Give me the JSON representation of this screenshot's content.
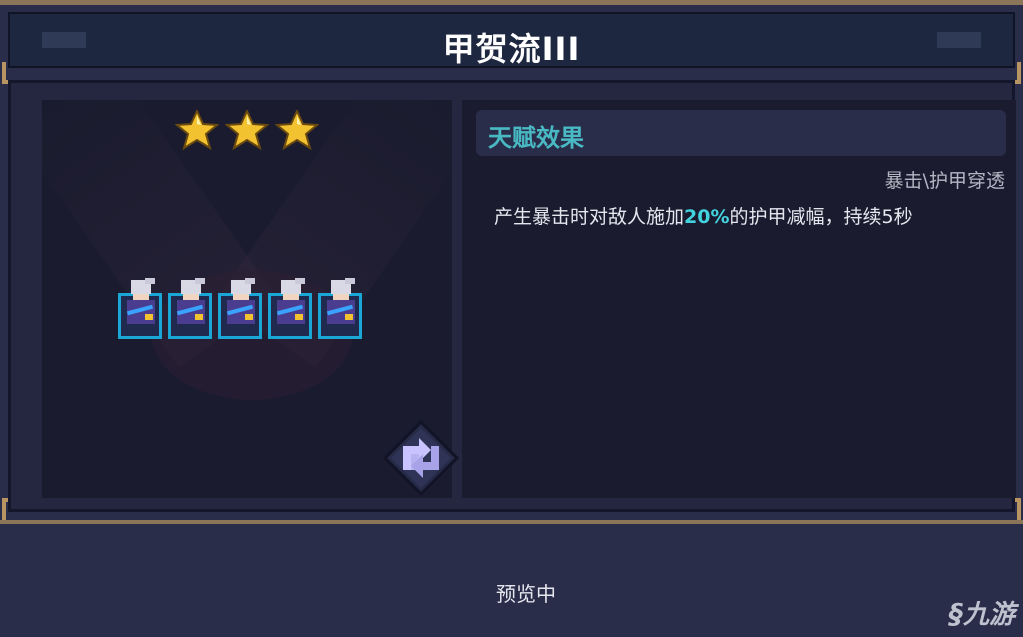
{
  "title": "甲贺流III",
  "stars_count": 3,
  "unit_count": 5,
  "talent": {
    "header": "天赋效果",
    "tags": "暴击\\护甲穿透",
    "desc_before": "产生暴击时对敌人施加",
    "desc_highlight": "20%",
    "desc_after": "的护甲减幅，持续5秒"
  },
  "preview_label": "预览中",
  "watermark": "九游",
  "colors": {
    "accent_teal": "#49b9c4",
    "highlight": "#43d3df",
    "star_gold": "#f2c230",
    "unit_border": "#1aa7d6",
    "frame_gold": "#b89463"
  },
  "icons": [
    "star-icon",
    "ninja-unit-icon",
    "swap-icon",
    "jiuyou-logo-icon"
  ]
}
